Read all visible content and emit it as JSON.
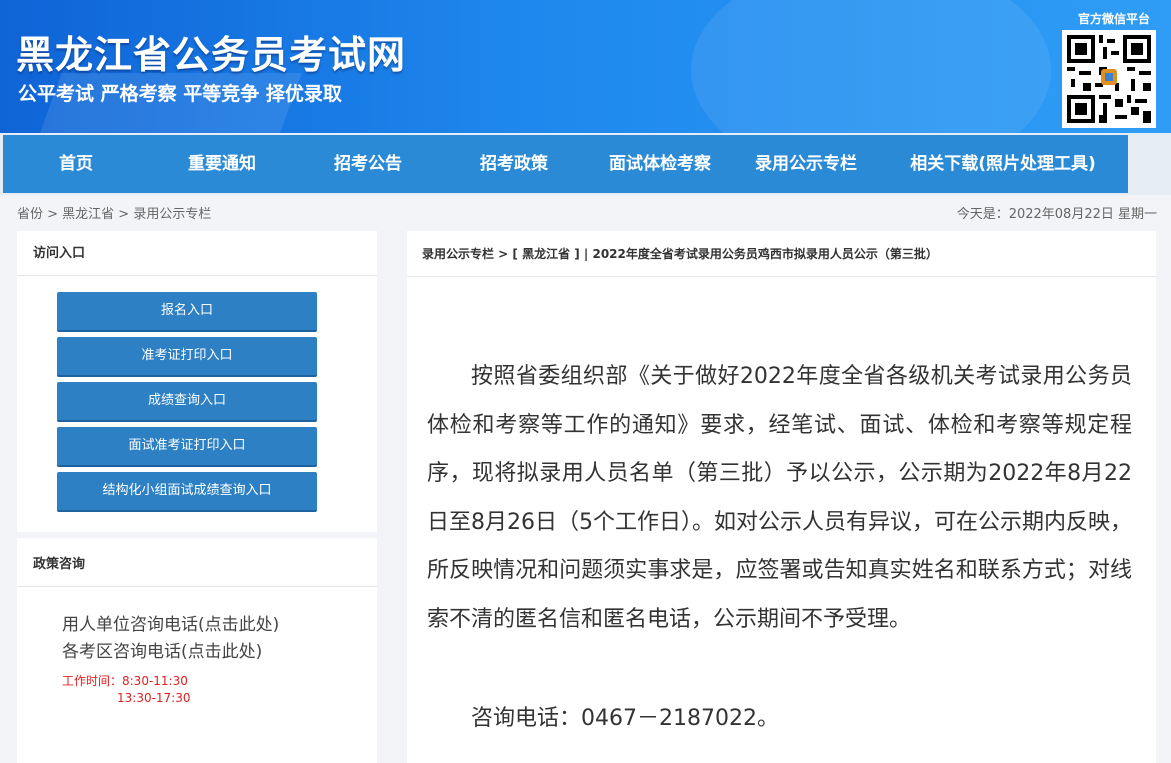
{
  "header": {
    "title": "黑龙江省公务员考试网",
    "slogan": "公平考试 严格考察 平等竞争 择优录取",
    "wechat_label": "官方微信平台",
    "qr_icon": "qr-code-icon"
  },
  "nav": {
    "items": [
      "首页",
      "重要通知",
      "招考公告",
      "招考政策",
      "面试体检考察",
      "录用公示专栏",
      "相关下载(照片处理工具)"
    ]
  },
  "breadcrumb": "省份 > 黑龙江省  > 录用公示专栏",
  "date": "今天是：2022年08月22日 星期一",
  "sidebar": {
    "access_title": "访问入口",
    "buttons": [
      "报名入口",
      "准考证打印入口",
      "成绩查询入口",
      "面试准考证打印入口",
      "结构化小组面试成绩查询入口"
    ],
    "policy_title": "政策咨询",
    "phone_links": [
      "用人单位咨询电话(点击此处)",
      "各考区咨询电话(点击此处)"
    ],
    "work_hours_label": "工作时间：8:30-11:30",
    "work_hours_pm": "13:30-17:30"
  },
  "main": {
    "breadcrumb": "录用公示专栏 > [ 黑龙江省 ] | 2022年度全省考试录用公务员鸡西市拟录用人员公示（第三批）",
    "paragraph": "按照省委组织部《关于做好2022年度全省各级机关考试录用公务员体检和考察等工作的通知》要求，经笔试、面试、体检和考察等规定程序，现将拟录用人员名单（第三批）予以公示，公示期为2022年8月22日至8月26日（5个工作日）。如对公示人员有异议，可在公示期内反映，所反映情况和问题须实事求是，应签署或告知真实姓名和联系方式；对线索不清的匿名信和匿名电话，公示期间不予受理。",
    "contact": "咨询电话：0467－2187022。"
  }
}
